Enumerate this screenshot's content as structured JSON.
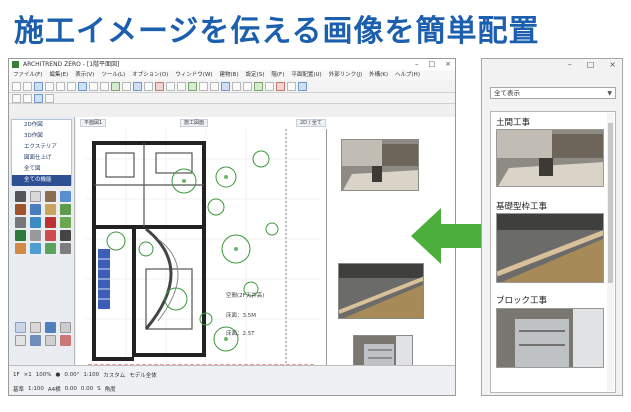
{
  "headline": "施工イメージを伝える画像を簡単配置",
  "cad": {
    "title": "ARCHITREND ZERO - [1階平面図]",
    "win_controls": [
      "–",
      "□",
      "×"
    ],
    "menu": [
      "ファイル(F)",
      "編集(E)",
      "表示(V)",
      "ツール(L)",
      "オプション(O)",
      "ウィンドウ(W)",
      "建物(B)",
      "設定(S)",
      "階(F)",
      "平面配置(U)",
      "外部リンク(J)",
      "外構(K)",
      "ヘルプ(H)"
    ],
    "nav_items": [
      "2D作図",
      "3D作図",
      "エクステリア",
      "図面仕上げ",
      "全て図",
      "全ての機能"
    ],
    "nav_selected_index": 5,
    "sheet_tab_1": "平面図1",
    "sheet_tab_2": "施工図面",
    "sheet_tab_3": "2D / 全て",
    "annotations": [
      "空間(2F天井高)",
      "床面：3.5M",
      "床面：2.5T"
    ],
    "status_row_1": [
      "1F",
      "×1",
      "100%",
      "●",
      "0.00°",
      "1:100",
      "カスタム",
      "モデル全体"
    ],
    "status_row_2": [
      "基準",
      "1:100",
      "A4横",
      "0.00",
      "0.00",
      "S",
      "角度"
    ]
  },
  "panel": {
    "win_controls": [
      "–",
      "□",
      "×"
    ],
    "filter_value": "全て表示",
    "items": [
      {
        "label": "土間工事",
        "colors": [
          "#8e8a84",
          "#c2bdb4",
          "#6d645a",
          "#d9d3c8"
        ]
      },
      {
        "label": "基礎型枠工事",
        "colors": [
          "#6b6b69",
          "#a68a57",
          "#d8c19a",
          "#3f3f3d"
        ]
      },
      {
        "label": "ブロック工事",
        "colors": [
          "#7a7670",
          "#bfc2c5",
          "#5a5752",
          "#e0e2e4"
        ]
      }
    ]
  },
  "arrow_color": "#4caf3c",
  "headline_color": "#1b5fae"
}
